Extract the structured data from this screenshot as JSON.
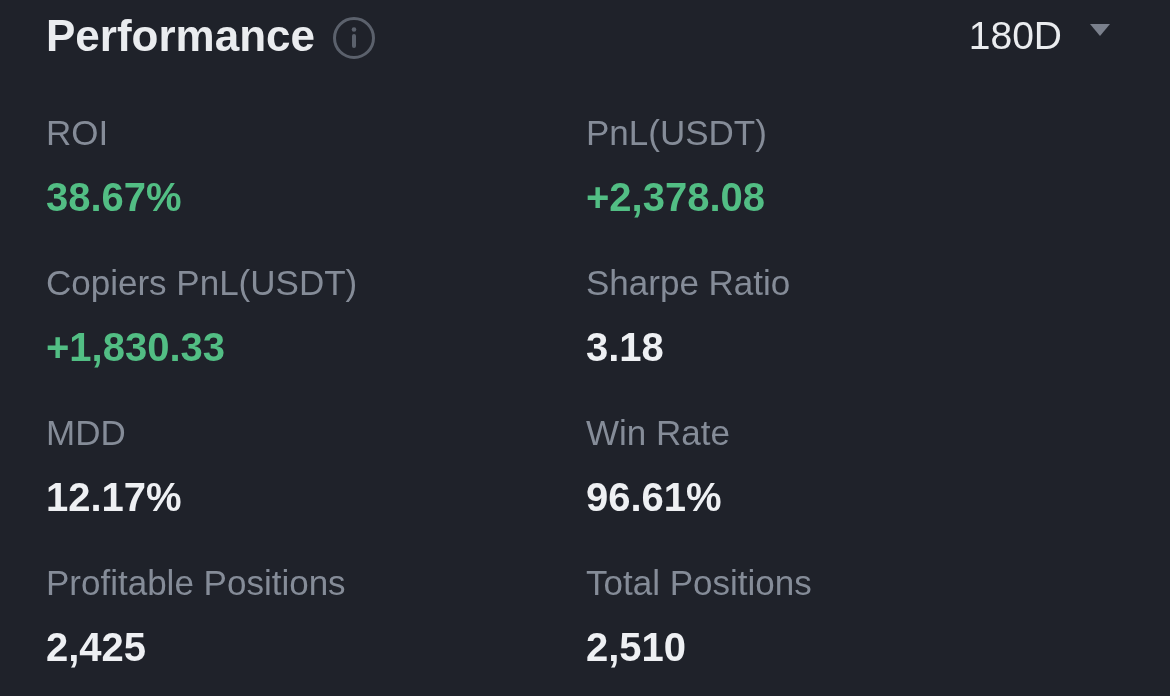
{
  "header": {
    "title": "Performance",
    "period": "180D"
  },
  "metrics": [
    {
      "label": "ROI",
      "value": "38.67%",
      "color": "#52be84"
    },
    {
      "label": "PnL(USDT)",
      "value": "+2,378.08",
      "color": "#52be84"
    },
    {
      "label": "Copiers PnL(USDT)",
      "value": "+1,830.33",
      "color": "#52be84"
    },
    {
      "label": "Sharpe Ratio",
      "value": "3.18",
      "color": "#eef0f3"
    },
    {
      "label": "MDD",
      "value": "12.17%",
      "color": "#eef0f3"
    },
    {
      "label": "Win Rate",
      "value": "96.61%",
      "color": "#eef0f3"
    },
    {
      "label": "Profitable Positions",
      "value": "2,425",
      "color": "#eef0f3"
    },
    {
      "label": "Total Positions",
      "value": "2,510",
      "color": "#eef0f3"
    }
  ]
}
